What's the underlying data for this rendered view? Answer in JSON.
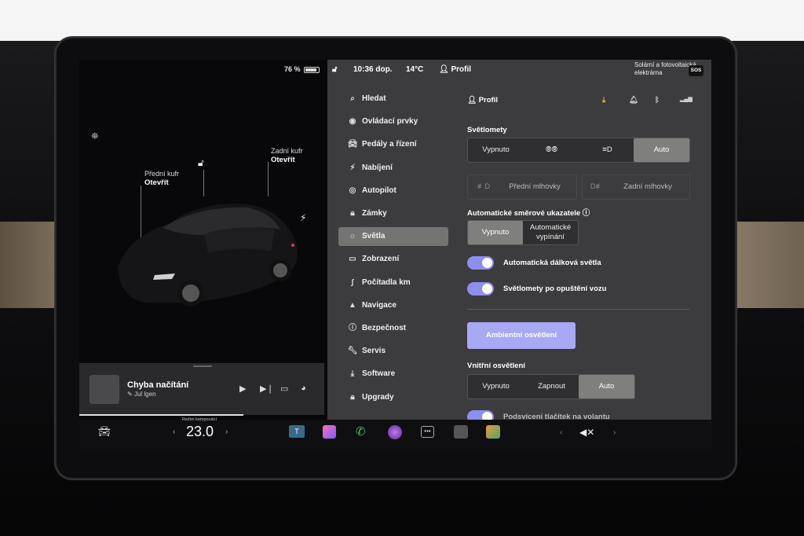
{
  "status": {
    "battery": "76 %",
    "battery_level": 0.76,
    "lock_icon": "unlock-icon",
    "time": "10:36 dop.",
    "temperature": "14°C",
    "profile": "Profil",
    "solar_line1": "Solární a fotovoltaická",
    "solar_line2": "elektrárna",
    "sos": "SOS"
  },
  "car": {
    "front_trunk_label": "Přední kufr",
    "front_trunk_action": "Otevřít",
    "rear_trunk_label": "Zadní kufr",
    "rear_trunk_action": "Otevřít"
  },
  "media": {
    "title": "Chyba načítání",
    "source": "Jul lgen"
  },
  "menu": {
    "items": [
      {
        "label": "Hledat",
        "icon": "search-icon"
      },
      {
        "label": "Ovládací prvky",
        "icon": "toggle-icon"
      },
      {
        "label": "Pedály a řízení",
        "icon": "car-icon"
      },
      {
        "label": "Nabíjení",
        "icon": "bolt-icon"
      },
      {
        "label": "Autopilot",
        "icon": "steering-wheel-icon"
      },
      {
        "label": "Zámky",
        "icon": "lock-icon"
      },
      {
        "label": "Světla",
        "icon": "sun-icon",
        "active": true
      },
      {
        "label": "Zobrazení",
        "icon": "display-icon"
      },
      {
        "label": "Počítadla km",
        "icon": "odometer-icon"
      },
      {
        "label": "Navigace",
        "icon": "navigation-icon"
      },
      {
        "label": "Bezpečnost",
        "icon": "alert-icon"
      },
      {
        "label": "Servis",
        "icon": "wrench-icon"
      },
      {
        "label": "Software",
        "icon": "download-icon"
      },
      {
        "label": "Upgrady",
        "icon": "bag-icon"
      }
    ]
  },
  "content": {
    "profile": "Profil",
    "headlights_title": "Světlomety",
    "headlights_options": [
      "Vypnuto",
      "",
      "",
      "Auto"
    ],
    "headlights_selected": "Auto",
    "fog_front": "Přední mlhovky",
    "fog_rear": "Zadní mlhovky",
    "signals_title": "Automatické směrové ukazatele",
    "signals_options": [
      "Vypnuto",
      "Automatické vypínání"
    ],
    "signals_selected": "Vypnuto",
    "auto_high_beam": "Automatická dálková světla",
    "auto_high_beam_on": true,
    "headlights_after_exit": "Světlomety po opuštění vozu",
    "headlights_after_exit_on": true,
    "ambient_button": "Ambientní osvětlení",
    "interior_title": "Vnitřní osvětlení",
    "interior_options": [
      "Vypnuto",
      "Zapnout",
      "Auto"
    ],
    "interior_selected": "Auto",
    "partial_next": "Podsvícení tlačítek na volantu"
  },
  "dock": {
    "climate_mode": "Režim kempování",
    "temperature": "23.0",
    "colors": {
      "accent": "#8e8ef0",
      "ambient": "#a8a8f5"
    }
  }
}
